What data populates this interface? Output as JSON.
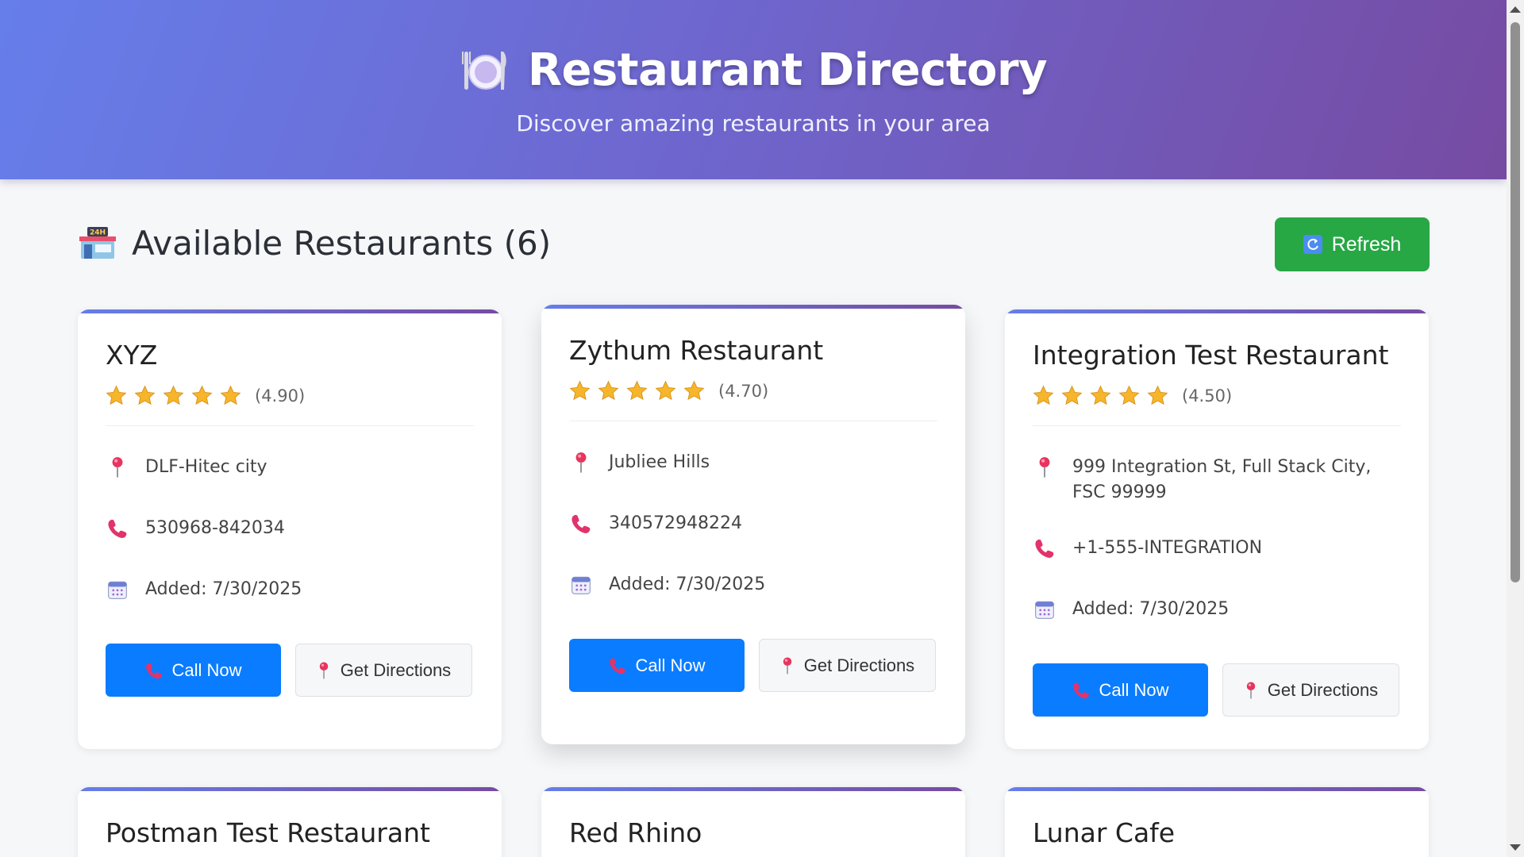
{
  "header": {
    "title": "Restaurant Directory",
    "subtitle": "Discover amazing restaurants in your area",
    "icon": "plate-cutlery-icon"
  },
  "section": {
    "title": "Available Restaurants (6)",
    "icon": "store-24h-icon"
  },
  "refresh": {
    "label": "Refresh",
    "icon": "refresh-icon",
    "color": "#28a745"
  },
  "colors": {
    "accent_start": "#667eea",
    "accent_end": "#764ba2",
    "call": "#0a7cff"
  },
  "restaurants": [
    {
      "name": "XYZ",
      "stars": 5,
      "rating": "(4.90)",
      "address": "DLF-Hitec city",
      "phone": "530968-842034",
      "added": "Added: 7/30/2025",
      "call_label": "Call Now",
      "directions_label": "Get Directions"
    },
    {
      "name": "Zythum Restaurant",
      "stars": 5,
      "rating": "(4.70)",
      "address": "Jubliee Hills",
      "phone": "340572948224",
      "added": "Added: 7/30/2025",
      "call_label": "Call Now",
      "directions_label": "Get Directions"
    },
    {
      "name": "Integration Test Restaurant",
      "stars": 5,
      "rating": "(4.50)",
      "address": "999 Integration St, Full Stack City, FSC 99999",
      "phone": "+1-555-INTEGRATION",
      "added": "Added: 7/30/2025",
      "call_label": "Call Now",
      "directions_label": "Get Directions"
    },
    {
      "name": "Postman Test Restaurant"
    },
    {
      "name": "Red Rhino"
    },
    {
      "name": "Lunar Cafe"
    }
  ]
}
